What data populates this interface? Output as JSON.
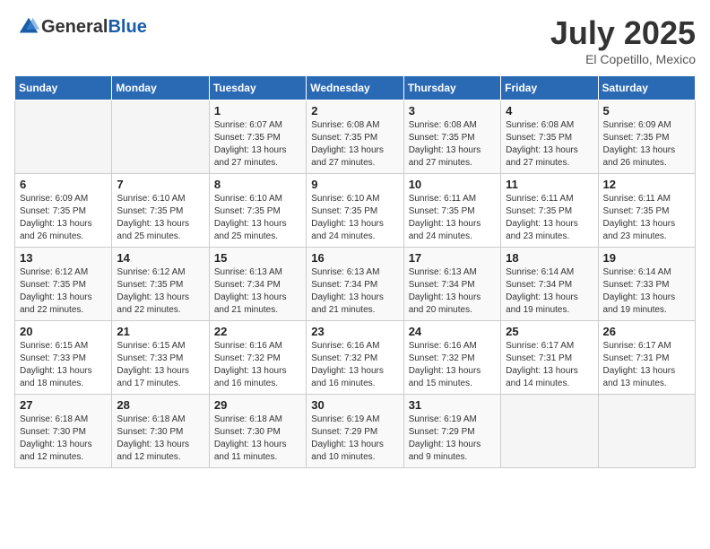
{
  "logo": {
    "text_general": "General",
    "text_blue": "Blue"
  },
  "title": {
    "month_year": "July 2025",
    "location": "El Copetillo, Mexico"
  },
  "days_of_week": [
    "Sunday",
    "Monday",
    "Tuesday",
    "Wednesday",
    "Thursday",
    "Friday",
    "Saturday"
  ],
  "weeks": [
    [
      {
        "day": "",
        "info": ""
      },
      {
        "day": "",
        "info": ""
      },
      {
        "day": "1",
        "info": "Sunrise: 6:07 AM\nSunset: 7:35 PM\nDaylight: 13 hours and 27 minutes."
      },
      {
        "day": "2",
        "info": "Sunrise: 6:08 AM\nSunset: 7:35 PM\nDaylight: 13 hours and 27 minutes."
      },
      {
        "day": "3",
        "info": "Sunrise: 6:08 AM\nSunset: 7:35 PM\nDaylight: 13 hours and 27 minutes."
      },
      {
        "day": "4",
        "info": "Sunrise: 6:08 AM\nSunset: 7:35 PM\nDaylight: 13 hours and 27 minutes."
      },
      {
        "day": "5",
        "info": "Sunrise: 6:09 AM\nSunset: 7:35 PM\nDaylight: 13 hours and 26 minutes."
      }
    ],
    [
      {
        "day": "6",
        "info": "Sunrise: 6:09 AM\nSunset: 7:35 PM\nDaylight: 13 hours and 26 minutes."
      },
      {
        "day": "7",
        "info": "Sunrise: 6:10 AM\nSunset: 7:35 PM\nDaylight: 13 hours and 25 minutes."
      },
      {
        "day": "8",
        "info": "Sunrise: 6:10 AM\nSunset: 7:35 PM\nDaylight: 13 hours and 25 minutes."
      },
      {
        "day": "9",
        "info": "Sunrise: 6:10 AM\nSunset: 7:35 PM\nDaylight: 13 hours and 24 minutes."
      },
      {
        "day": "10",
        "info": "Sunrise: 6:11 AM\nSunset: 7:35 PM\nDaylight: 13 hours and 24 minutes."
      },
      {
        "day": "11",
        "info": "Sunrise: 6:11 AM\nSunset: 7:35 PM\nDaylight: 13 hours and 23 minutes."
      },
      {
        "day": "12",
        "info": "Sunrise: 6:11 AM\nSunset: 7:35 PM\nDaylight: 13 hours and 23 minutes."
      }
    ],
    [
      {
        "day": "13",
        "info": "Sunrise: 6:12 AM\nSunset: 7:35 PM\nDaylight: 13 hours and 22 minutes."
      },
      {
        "day": "14",
        "info": "Sunrise: 6:12 AM\nSunset: 7:35 PM\nDaylight: 13 hours and 22 minutes."
      },
      {
        "day": "15",
        "info": "Sunrise: 6:13 AM\nSunset: 7:34 PM\nDaylight: 13 hours and 21 minutes."
      },
      {
        "day": "16",
        "info": "Sunrise: 6:13 AM\nSunset: 7:34 PM\nDaylight: 13 hours and 21 minutes."
      },
      {
        "day": "17",
        "info": "Sunrise: 6:13 AM\nSunset: 7:34 PM\nDaylight: 13 hours and 20 minutes."
      },
      {
        "day": "18",
        "info": "Sunrise: 6:14 AM\nSunset: 7:34 PM\nDaylight: 13 hours and 19 minutes."
      },
      {
        "day": "19",
        "info": "Sunrise: 6:14 AM\nSunset: 7:33 PM\nDaylight: 13 hours and 19 minutes."
      }
    ],
    [
      {
        "day": "20",
        "info": "Sunrise: 6:15 AM\nSunset: 7:33 PM\nDaylight: 13 hours and 18 minutes."
      },
      {
        "day": "21",
        "info": "Sunrise: 6:15 AM\nSunset: 7:33 PM\nDaylight: 13 hours and 17 minutes."
      },
      {
        "day": "22",
        "info": "Sunrise: 6:16 AM\nSunset: 7:32 PM\nDaylight: 13 hours and 16 minutes."
      },
      {
        "day": "23",
        "info": "Sunrise: 6:16 AM\nSunset: 7:32 PM\nDaylight: 13 hours and 16 minutes."
      },
      {
        "day": "24",
        "info": "Sunrise: 6:16 AM\nSunset: 7:32 PM\nDaylight: 13 hours and 15 minutes."
      },
      {
        "day": "25",
        "info": "Sunrise: 6:17 AM\nSunset: 7:31 PM\nDaylight: 13 hours and 14 minutes."
      },
      {
        "day": "26",
        "info": "Sunrise: 6:17 AM\nSunset: 7:31 PM\nDaylight: 13 hours and 13 minutes."
      }
    ],
    [
      {
        "day": "27",
        "info": "Sunrise: 6:18 AM\nSunset: 7:30 PM\nDaylight: 13 hours and 12 minutes."
      },
      {
        "day": "28",
        "info": "Sunrise: 6:18 AM\nSunset: 7:30 PM\nDaylight: 13 hours and 12 minutes."
      },
      {
        "day": "29",
        "info": "Sunrise: 6:18 AM\nSunset: 7:30 PM\nDaylight: 13 hours and 11 minutes."
      },
      {
        "day": "30",
        "info": "Sunrise: 6:19 AM\nSunset: 7:29 PM\nDaylight: 13 hours and 10 minutes."
      },
      {
        "day": "31",
        "info": "Sunrise: 6:19 AM\nSunset: 7:29 PM\nDaylight: 13 hours and 9 minutes."
      },
      {
        "day": "",
        "info": ""
      },
      {
        "day": "",
        "info": ""
      }
    ]
  ]
}
